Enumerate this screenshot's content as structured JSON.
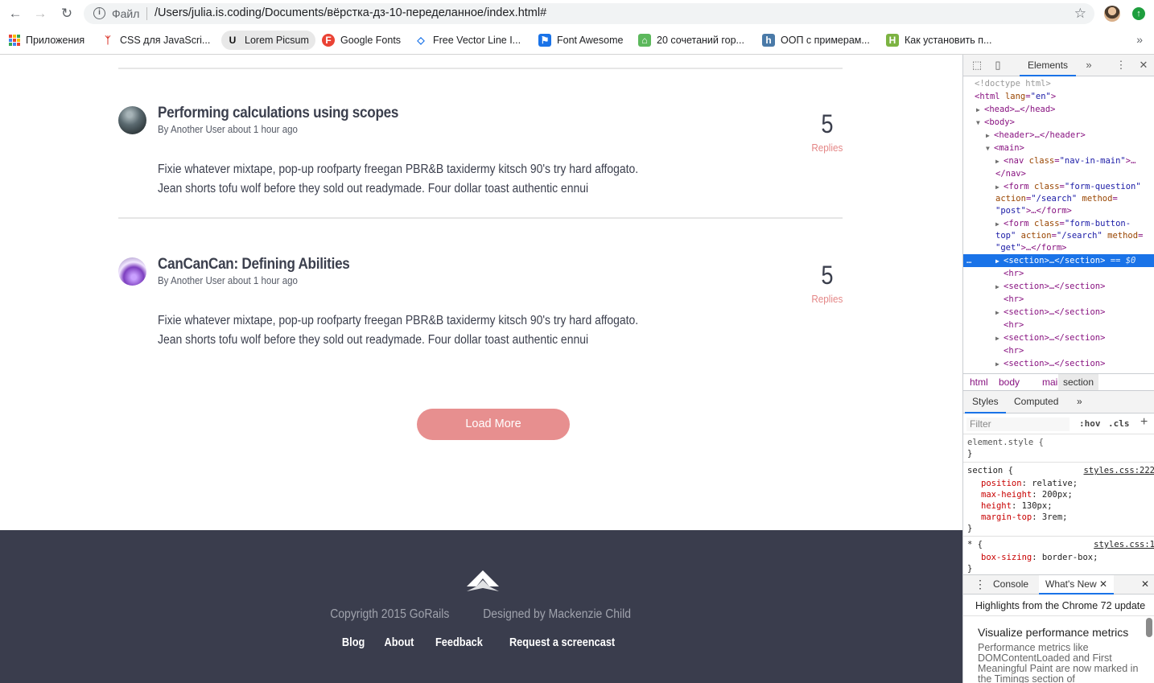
{
  "browser": {
    "nav": {
      "back": "←",
      "forward": "→",
      "reload": "↻"
    },
    "omnibox": {
      "scheme_label": "Файл",
      "url": "/Users/julia.is.coding/Documents/вёрстка-дз-10-переделанное/index.html#"
    },
    "bookmarks": [
      {
        "label": "Приложения",
        "icon": "apps-grid-icon"
      },
      {
        "label": "CSS для JavaScri...",
        "icon": "figure-icon"
      },
      {
        "label": "Lorem Picsum",
        "icon": "u-icon"
      },
      {
        "label": "Google Fonts",
        "icon": "f-icon"
      },
      {
        "label": "Free Vector Line I...",
        "icon": "diamond-icon"
      },
      {
        "label": "Font Awesome",
        "icon": "flag-icon"
      },
      {
        "label": "20 сочетаний гор...",
        "icon": "green-icon"
      },
      {
        "label": "ООП с примерам...",
        "icon": "h-icon"
      },
      {
        "label": "Как установить п...",
        "icon": "h-icon"
      }
    ],
    "colors": {
      "accent": "#1a73e8"
    }
  },
  "page": {
    "posts": [
      {
        "title": "Performing calculations using scopes",
        "meta": "By Another User about 1 hour ago",
        "body_line1": "Fixie whatever mixtape, pop-up roofparty freegan PBR&B taxidermy kitsch 90's try hard affogato.",
        "body_line2": "Jean shorts tofu wolf before they sold out readymade. Four dollar toast authentic ennui",
        "replies_count": "5",
        "replies_label": "Replies"
      },
      {
        "title": "CanCanCan: Defining Abilities",
        "meta": "By Another User about 1 hour ago",
        "body_line1": "Fixie whatever mixtape, pop-up roofparty freegan PBR&B taxidermy kitsch 90's try hard affogato.",
        "body_line2": "Jean shorts tofu wolf before they sold out readymade. Four dollar toast authentic ennui",
        "replies_count": "5",
        "replies_label": "Replies"
      }
    ],
    "load_more": "Load More",
    "footer": {
      "copyright": "Copyrigth 2015 GoRails",
      "designed_by": "Designed by Mackenzie Child",
      "links": [
        "Blog",
        "About",
        "Feedback",
        "Request a screencast"
      ]
    },
    "colors": {
      "accent": "#e78f8f",
      "footer_bg": "#3a3d4d",
      "text": "#3b3f4d"
    }
  },
  "devtools": {
    "tab_elements": "Elements",
    "dom": {
      "doctype": "<!doctype html>",
      "html_open_tag": "html",
      "html_attr": "lang",
      "html_val": "\"en\"",
      "head": "<head>…</head>",
      "body": "<body>",
      "header": "<header>…</header>",
      "main": "<main>",
      "nav_tag": "nav",
      "nav_attr": "class",
      "nav_val": "\"nav-in-main\"",
      "nav_close": "</nav>",
      "form1_attr": "class",
      "form1_val": "\"form-question\"",
      "form1_action": "action",
      "form1_action_val": "\"/search\"",
      "form1_method": "method",
      "form1_method_val": "\"post\"",
      "form1_close": ">…</form>",
      "form2_val": "\"form-button-",
      "form2_val2": "top\"",
      "form2_method_val": "\"get\"",
      "section_selected": "<section>…</section>",
      "selected_marker": "== $0",
      "section": "<section>…</section>",
      "hr": "<hr>"
    },
    "breadcrumbs": [
      "html",
      "body",
      "main",
      "section"
    ],
    "styles_tabs": [
      "Styles",
      "Computed"
    ],
    "filter_placeholder": "Filter",
    "filter_hov": ":hov",
    "filter_cls": ".cls",
    "rules": {
      "element_style": "element.style {",
      "close": "}",
      "section_selector": "section {",
      "section_source": "styles.css:222",
      "p1": "position",
      "v1": "relative;",
      "p2": "max-height",
      "v2": "200px;",
      "p3": "height",
      "v3": "130px;",
      "p4": "margin-top",
      "v4": "3rem;",
      "star_selector": "* {",
      "star_source": "styles.css:1",
      "p5": "box-sizing",
      "v5": "border-box;"
    },
    "drawer_tabs": [
      "Console",
      "What's New"
    ],
    "whatsnew_header": "Highlights from the Chrome 72 update",
    "whatsnew_title": "Visualize performance metrics",
    "whatsnew_desc": "Performance metrics like DOMContentLoaded and First Meaningful Paint are now marked in the Timings section of"
  }
}
